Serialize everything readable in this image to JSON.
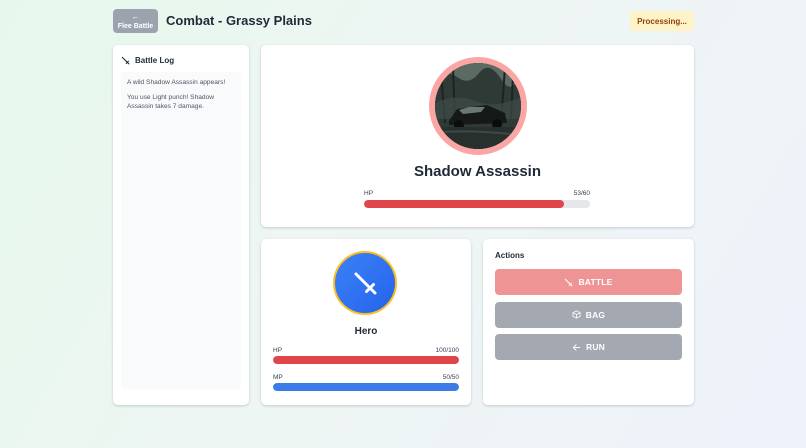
{
  "header": {
    "flee_label": "Flee Battle",
    "title": "Combat - Grassy Plains",
    "status": "Processing..."
  },
  "battle_log": {
    "title": "Battle Log",
    "entries": [
      "A wild Shadow Assassin appears!",
      "You use Light punch! Shadow Assassin takes 7 damage."
    ]
  },
  "enemy": {
    "name": "Shadow Assassin",
    "hp_label": "HP",
    "hp_text": "53/60",
    "hp_current": 53,
    "hp_max": 60,
    "portrait_icon": "enemy-portrait-image",
    "ring_color": "#fca5a5"
  },
  "hero": {
    "name": "Hero",
    "hp_label": "HP",
    "hp_text": "100/100",
    "hp_current": 100,
    "hp_max": 100,
    "mp_label": "MP",
    "mp_text": "50/50",
    "mp_current": 50,
    "mp_max": 50,
    "portrait_icon": "sword-icon",
    "ring_color": "#fbbf24"
  },
  "actions": {
    "title": "Actions",
    "battle_label": "BATTLE",
    "bag_label": "BAG",
    "run_label": "RUN"
  },
  "colors": {
    "hp_bar": "#e0454a",
    "mp_bar": "#3b7ce8",
    "battle_button": "#ee9494",
    "secondary_button": "#a3a8b1",
    "status_badge_bg": "#fef3c7"
  }
}
